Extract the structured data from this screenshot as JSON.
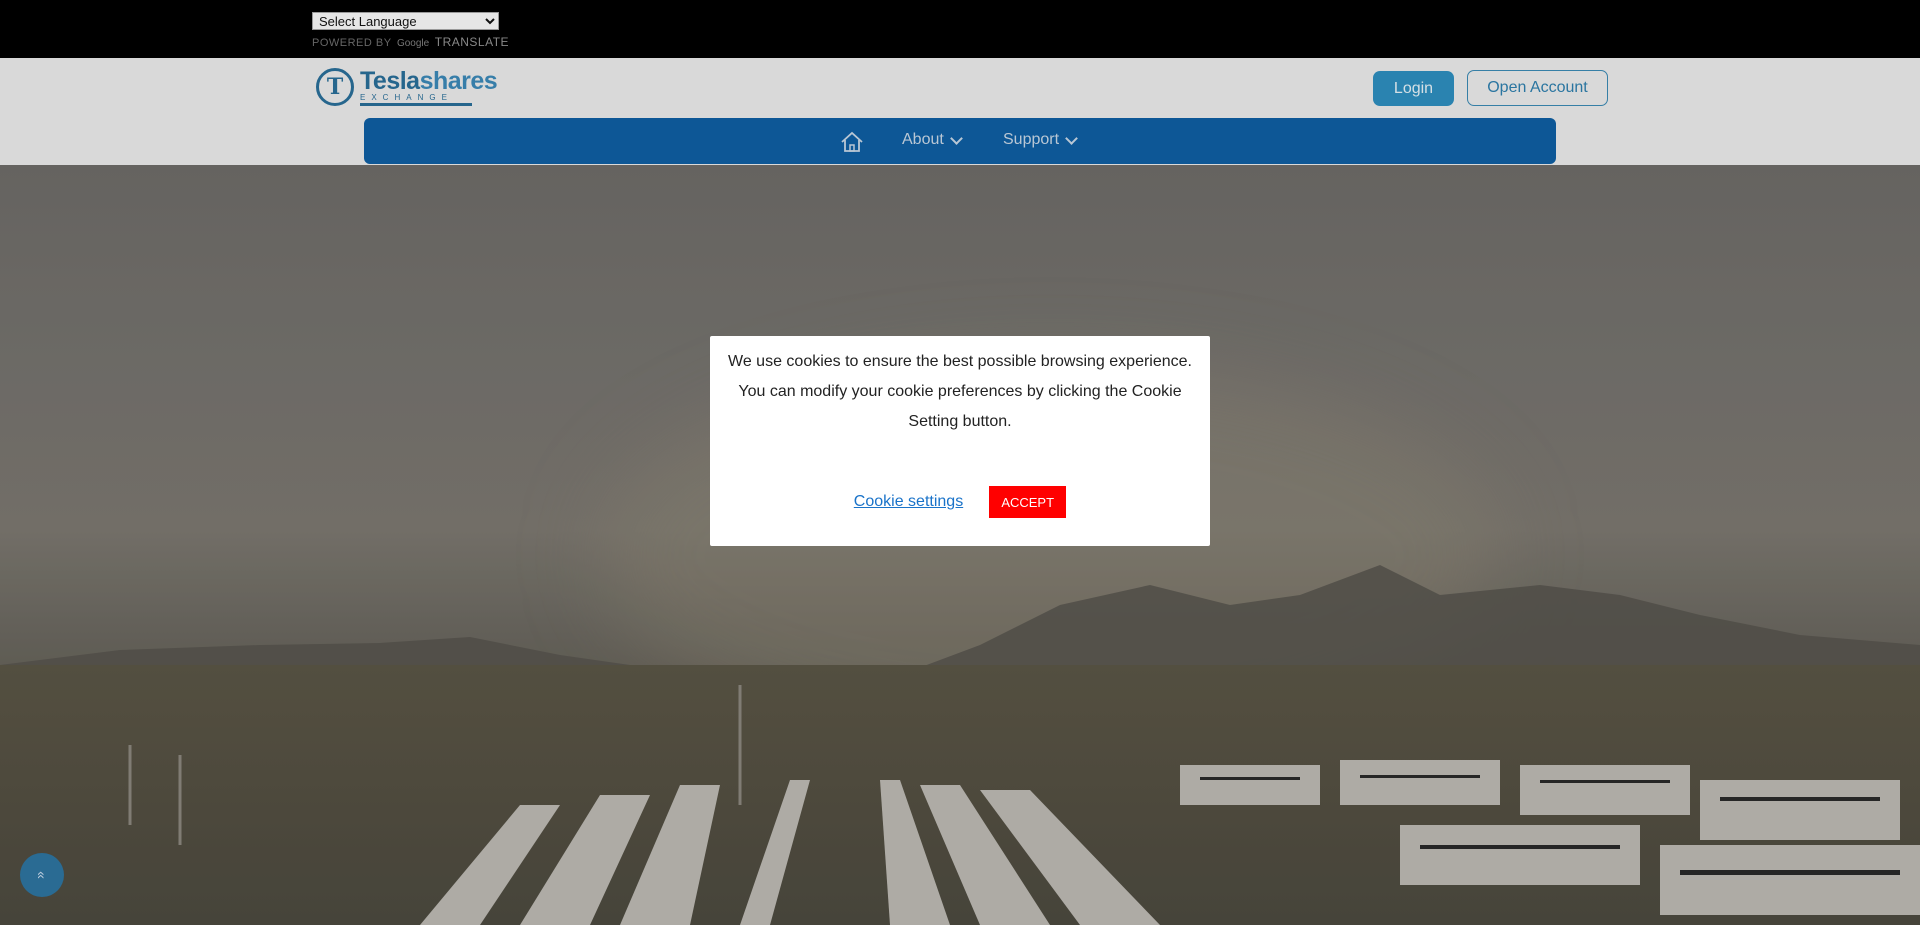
{
  "translate": {
    "select_value": "Select Language",
    "powered_prefix": "POWERED BY",
    "google": "Google",
    "translate_label": "TRANSLATE"
  },
  "header": {
    "logo_name_main": "Tesla",
    "logo_name_accent": "shares",
    "logo_sub": "EXCHANGE",
    "login_label": "Login",
    "open_account_label": "Open Account"
  },
  "nav": {
    "home_icon": "home-icon",
    "items": [
      {
        "label": "About"
      },
      {
        "label": "Support"
      }
    ]
  },
  "cookie": {
    "message": "We use cookies to ensure the best possible browsing experience. You can modify your cookie preferences by clicking the Cookie Setting button.",
    "settings_label": "Cookie settings",
    "accept_label": "ACCEPT"
  },
  "scroll_top": {
    "icon": "double-chevron-up-icon",
    "glyph": "«"
  },
  "colors": {
    "brand": "#0f5fa3",
    "login": "#2e8fbf",
    "accept": "#ff0000",
    "link": "#1a73c9"
  }
}
